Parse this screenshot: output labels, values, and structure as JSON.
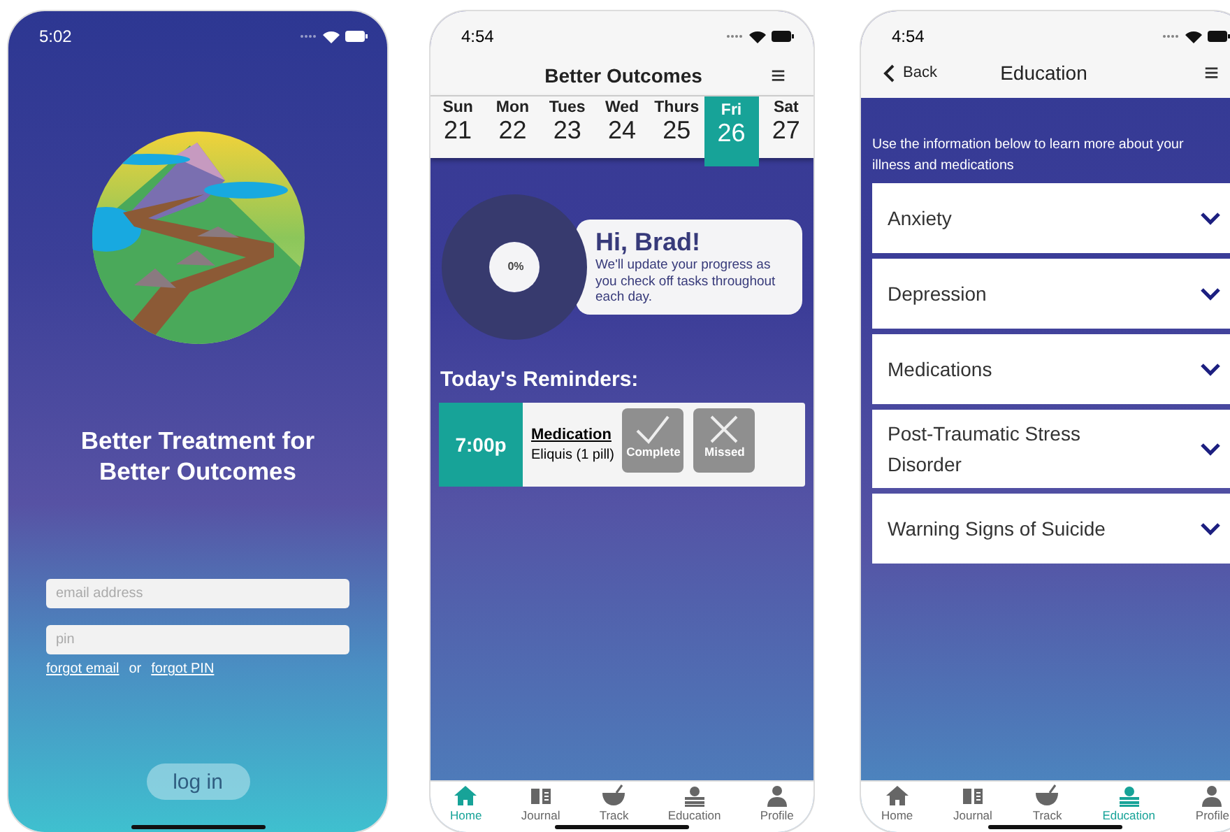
{
  "screens": [
    {
      "kind": "login",
      "status_time": "5:02",
      "title": "Better Treatment for Better Outcomes",
      "fields": [
        {
          "placeholder": "email address"
        },
        {
          "placeholder": "pin"
        }
      ],
      "links": [
        {
          "kind": "link",
          "label": "forgot email"
        },
        {
          "kind": "text",
          "label": "or"
        },
        {
          "kind": "link",
          "label": "forgot PIN"
        }
      ],
      "button": "log in"
    },
    {
      "kind": "home",
      "status_time": "4:54",
      "nav_title": "Better Outcomes",
      "menu": "≡",
      "days": [
        {
          "day": "Sun",
          "date": "21",
          "selected": false
        },
        {
          "day": "Mon",
          "date": "22",
          "selected": false
        },
        {
          "day": "Tues",
          "date": "23",
          "selected": false
        },
        {
          "day": "Wed",
          "date": "24",
          "selected": false
        },
        {
          "day": "Thurs",
          "date": "25",
          "selected": false
        },
        {
          "day": "Fri",
          "date": "26",
          "selected": true
        },
        {
          "day": "Sat",
          "date": "27",
          "selected": false
        }
      ],
      "progress": {
        "level": 0,
        "reading": "0%"
      },
      "greeting": "Hi, Brad!",
      "message": "We'll update your progress as you check off tasks throughout each day.",
      "reminders_title": "Today's Reminders:",
      "reminders": [
        {
          "time": "7:00p",
          "title": "Medication",
          "detail": "Eliquis (1 pill)",
          "actions": [
            {
              "kind": "check",
              "label": "Complete"
            },
            {
              "kind": "cross",
              "label": "Missed"
            }
          ]
        }
      ],
      "tabs": [
        {
          "kind": "home",
          "label": "Home",
          "selected": true
        },
        {
          "kind": "journal",
          "label": "Journal",
          "selected": false
        },
        {
          "kind": "track",
          "label": "Track",
          "selected": false
        },
        {
          "kind": "education",
          "label": "Education",
          "selected": false
        },
        {
          "kind": "profile",
          "label": "Profile",
          "selected": false
        }
      ]
    },
    {
      "kind": "education",
      "status_time": "4:54",
      "back": "Back",
      "nav_title": "Education",
      "menu": "≡",
      "intro": "Use the information below to learn more about your illness and medications",
      "topics": [
        {
          "label": "Anxiety",
          "expanded": false
        },
        {
          "label": "Depression",
          "expanded": false
        },
        {
          "label": "Medications",
          "expanded": false
        },
        {
          "label": "Post-Traumatic Stress Disorder",
          "expanded": false
        },
        {
          "label": "Warning Signs of Suicide",
          "expanded": false
        }
      ],
      "tabs": [
        {
          "kind": "home",
          "label": "Home",
          "selected": false
        },
        {
          "kind": "journal",
          "label": "Journal",
          "selected": false
        },
        {
          "kind": "track",
          "label": "Track",
          "selected": false
        },
        {
          "kind": "education",
          "label": "Education",
          "selected": true
        },
        {
          "kind": "profile",
          "label": "Profile",
          "selected": false
        }
      ]
    }
  ]
}
